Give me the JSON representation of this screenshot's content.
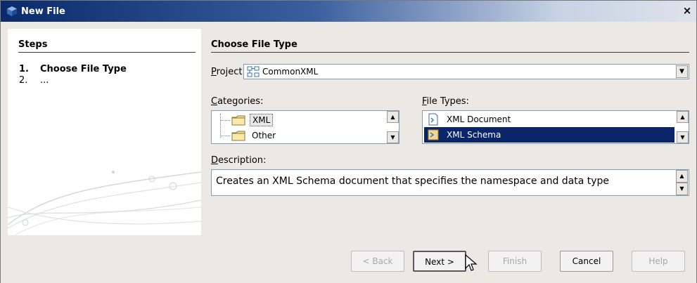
{
  "window": {
    "title": "New File",
    "close_glyph": "×"
  },
  "steps": {
    "title": "Steps",
    "items": [
      {
        "num": "1.",
        "label": "Choose File Type"
      },
      {
        "num": "2.",
        "label": "..."
      }
    ]
  },
  "main": {
    "title": "Choose File Type",
    "project": {
      "label_u": "P",
      "label_rest": "roject:",
      "value": "CommonXML"
    },
    "categories": {
      "label_u": "C",
      "label_rest": "ategories:",
      "items": [
        "XML",
        "Other"
      ],
      "selected": "XML"
    },
    "file_types": {
      "label_u": "F",
      "label_rest": "ile Types:",
      "items": [
        "XML Document",
        "XML Schema"
      ],
      "selected": "XML Schema"
    },
    "description": {
      "label_u": "D",
      "label_rest": "escription:",
      "text": "Creates an XML Schema document that specifies the namespace and data type"
    }
  },
  "buttons": {
    "back": "< Back",
    "next": "Next >",
    "finish": "Finish",
    "cancel": "Cancel",
    "help": "Help"
  },
  "colors": {
    "selection": "#0a246a",
    "title_bar": "#0a2a6b"
  }
}
